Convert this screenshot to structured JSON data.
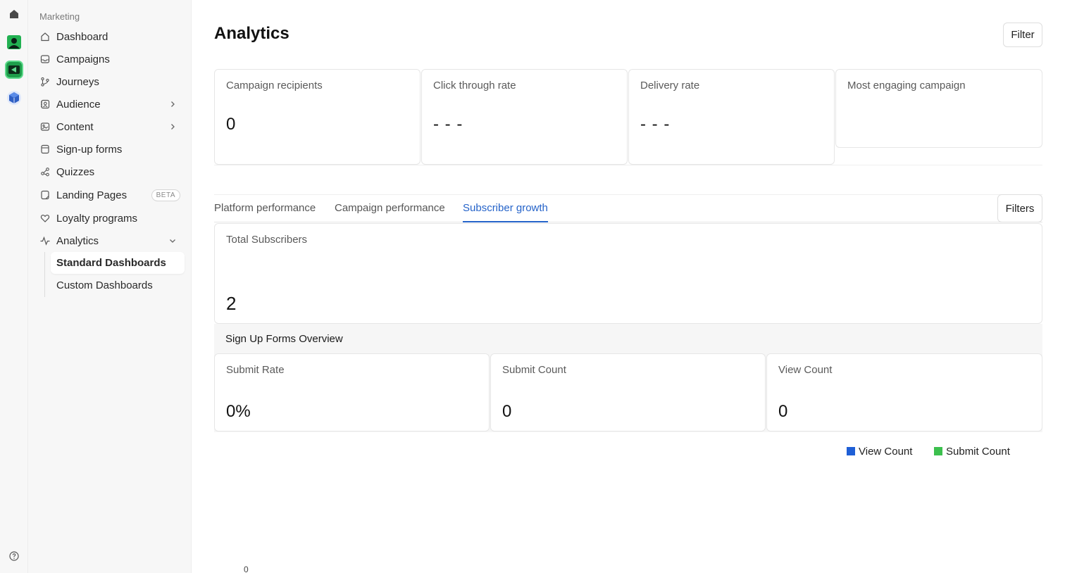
{
  "rail": {
    "icons": [
      "home-icon",
      "contact-app-icon",
      "marketing-app-icon",
      "cube-app-icon",
      "help-icon"
    ]
  },
  "sidebar": {
    "section_label": "Marketing",
    "items": [
      {
        "label": "Dashboard",
        "icon": "home-icon"
      },
      {
        "label": "Campaigns",
        "icon": "inbox-icon"
      },
      {
        "label": "Journeys",
        "icon": "branch-icon"
      },
      {
        "label": "Audience",
        "icon": "contacts-icon",
        "expandable": true
      },
      {
        "label": "Content",
        "icon": "image-icon",
        "expandable": true
      },
      {
        "label": "Sign-up forms",
        "icon": "form-icon"
      },
      {
        "label": "Quizzes",
        "icon": "quiz-icon"
      },
      {
        "label": "Landing Pages",
        "icon": "page-icon",
        "badge": "BETA"
      },
      {
        "label": "Loyalty programs",
        "icon": "heart-icon"
      },
      {
        "label": "Analytics",
        "icon": "activity-icon",
        "expanded": true
      }
    ],
    "analytics_subitems": [
      {
        "label": "Standard Dashboards",
        "active": true
      },
      {
        "label": "Custom Dashboards",
        "active": false
      }
    ]
  },
  "header": {
    "title": "Analytics",
    "filter_label": "Filter"
  },
  "kpis": [
    {
      "label": "Campaign recipients",
      "value": "0"
    },
    {
      "label": "Click through rate",
      "value": "- - -"
    },
    {
      "label": "Delivery rate",
      "value": "- - -"
    },
    {
      "label": "Most engaging campaign",
      "value": ""
    }
  ],
  "tabs": {
    "items": [
      {
        "label": "Platform performance",
        "active": false
      },
      {
        "label": "Campaign performance",
        "active": false
      },
      {
        "label": "Subscriber growth",
        "active": true
      }
    ],
    "filters_label": "Filters"
  },
  "subscribers": {
    "label": "Total Subscribers",
    "value": "2"
  },
  "signup_forms": {
    "title": "Sign Up Forms Overview",
    "cards": [
      {
        "label": "Submit Rate",
        "value": "0%"
      },
      {
        "label": "Submit Count",
        "value": "0"
      },
      {
        "label": "View Count",
        "value": "0"
      }
    ]
  },
  "chart_data": {
    "type": "bar",
    "series": [
      {
        "name": "View Count",
        "color": "#1f5fd6",
        "values": []
      },
      {
        "name": "Submit Count",
        "color": "#3cc04e",
        "values": []
      }
    ],
    "y_tick_labels": [
      "0"
    ],
    "legend_position": "top-right"
  },
  "colors": {
    "accent": "#2563c9",
    "view_count": "#1f5fd6",
    "submit_count": "#3cc04e"
  }
}
